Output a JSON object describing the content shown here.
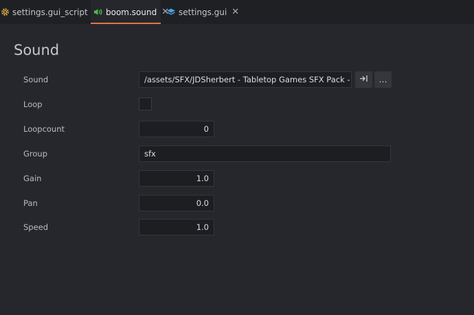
{
  "tabs": [
    {
      "label": "settings.gui_script",
      "icon": "gear-icon"
    },
    {
      "label": "boom.sound",
      "icon": "speaker-icon"
    },
    {
      "label": "settings.gui",
      "icon": "layers-icon"
    }
  ],
  "close_glyph": "✕",
  "panel": {
    "title": "Sound"
  },
  "properties": {
    "sound": {
      "label": "Sound",
      "value": "/assets/SFX/JDSherbert - Tabletop Games SFX Pack - Deck Deal"
    },
    "loop": {
      "label": "Loop",
      "checked": false
    },
    "loopcount": {
      "label": "Loopcount",
      "value": "0"
    },
    "group": {
      "label": "Group",
      "value": "sfx"
    },
    "gain": {
      "label": "Gain",
      "value": "1.0"
    },
    "pan": {
      "label": "Pan",
      "value": "0.0"
    },
    "speed": {
      "label": "Speed",
      "value": "1.0"
    }
  },
  "buttons": {
    "goto_icon": "goto-resource-icon",
    "browse_label": "…"
  },
  "colors": {
    "accent": "#e5763a",
    "speaker": "#4cc24a",
    "gear": "#e2b43d",
    "layers": "#4aa0e0"
  }
}
